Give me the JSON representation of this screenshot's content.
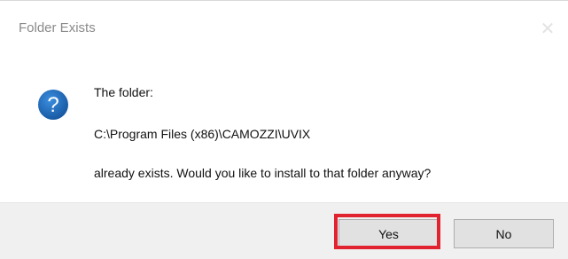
{
  "window": {
    "title": "Folder Exists",
    "close_icon": "close-icon"
  },
  "message": {
    "icon": "question-icon",
    "line1": "The folder:",
    "line2": "C:\\Program Files (x86)\\CAMOZZI\\UVIX",
    "line3": "already exists. Would you like to install to that folder anyway?"
  },
  "buttons": {
    "yes_label": "Yes",
    "no_label": "No"
  },
  "colors": {
    "highlight": "#e0232f",
    "icon_blue": "#1c6fc5",
    "footer_bg": "#f0f0f0"
  }
}
